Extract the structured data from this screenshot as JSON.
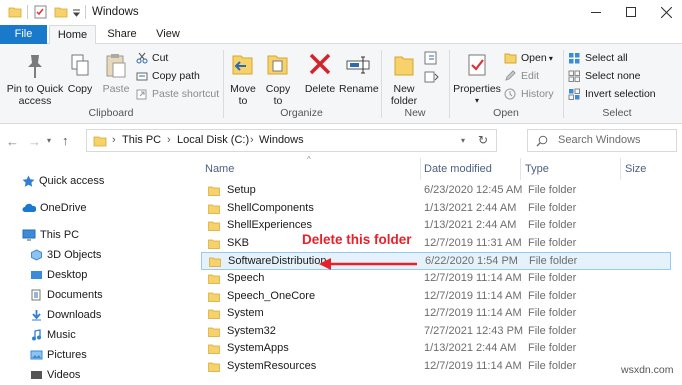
{
  "window": {
    "title": "Windows"
  },
  "tabs": {
    "file": "File",
    "home": "Home",
    "share": "Share",
    "view": "View"
  },
  "ribbon": {
    "clipboard": {
      "pin": [
        "Pin to Quick",
        "access"
      ],
      "copy": "Copy",
      "paste": "Paste",
      "cut": "Cut",
      "copy_path": "Copy path",
      "paste_shortcut": "Paste shortcut",
      "label": "Clipboard"
    },
    "organize": {
      "move_to": [
        "Move",
        "to"
      ],
      "copy_to": [
        "Copy",
        "to"
      ],
      "delete": "Delete",
      "rename": "Rename",
      "label": "Organize"
    },
    "new": {
      "new_folder": [
        "New",
        "folder"
      ],
      "label": "New"
    },
    "open": {
      "properties": "Properties",
      "open": "Open",
      "edit": "Edit",
      "history": "History",
      "label": "Open"
    },
    "select": {
      "select_all": "Select all",
      "select_none": "Select none",
      "invert": "Invert selection",
      "label": "Select"
    }
  },
  "address": {
    "crumbs": [
      "This PC",
      "Local Disk (C:)",
      "Windows"
    ],
    "search_placeholder": "Search Windows"
  },
  "nav": {
    "items": [
      "Quick access",
      "OneDrive",
      "This PC",
      "3D Objects",
      "Desktop",
      "Documents",
      "Downloads",
      "Music",
      "Pictures",
      "Videos"
    ]
  },
  "columns": {
    "name": "Name",
    "date": "Date modified",
    "type": "Type",
    "size": "Size"
  },
  "files": [
    {
      "name": "Setup",
      "date": "6/23/2020 12:45 AM",
      "type": "File folder"
    },
    {
      "name": "ShellComponents",
      "date": "1/13/2021 2:44 AM",
      "type": "File folder"
    },
    {
      "name": "ShellExperiences",
      "date": "1/13/2021 2:44 AM",
      "type": "File folder"
    },
    {
      "name": "SKB",
      "date": "12/7/2019 11:31 AM",
      "type": "File folder"
    },
    {
      "name": "SoftwareDistribution",
      "date": "6/22/2020 1:54 PM",
      "type": "File folder"
    },
    {
      "name": "Speech",
      "date": "12/7/2019 11:14 AM",
      "type": "File folder"
    },
    {
      "name": "Speech_OneCore",
      "date": "12/7/2019 11:14 AM",
      "type": "File folder"
    },
    {
      "name": "System",
      "date": "12/7/2019 11:14 AM",
      "type": "File folder"
    },
    {
      "name": "System32",
      "date": "7/27/2021 12:43 PM",
      "type": "File folder"
    },
    {
      "name": "SystemApps",
      "date": "1/13/2021 2:44 AM",
      "type": "File folder"
    },
    {
      "name": "SystemResources",
      "date": "12/7/2019 11:14 AM",
      "type": "File folder"
    }
  ],
  "annotation": {
    "text": "Delete this folder"
  },
  "watermark": "wsxdn.com",
  "colors": {
    "accent": "#1979ca",
    "annotation": "#e8202a",
    "folder": "#f7d26a"
  }
}
